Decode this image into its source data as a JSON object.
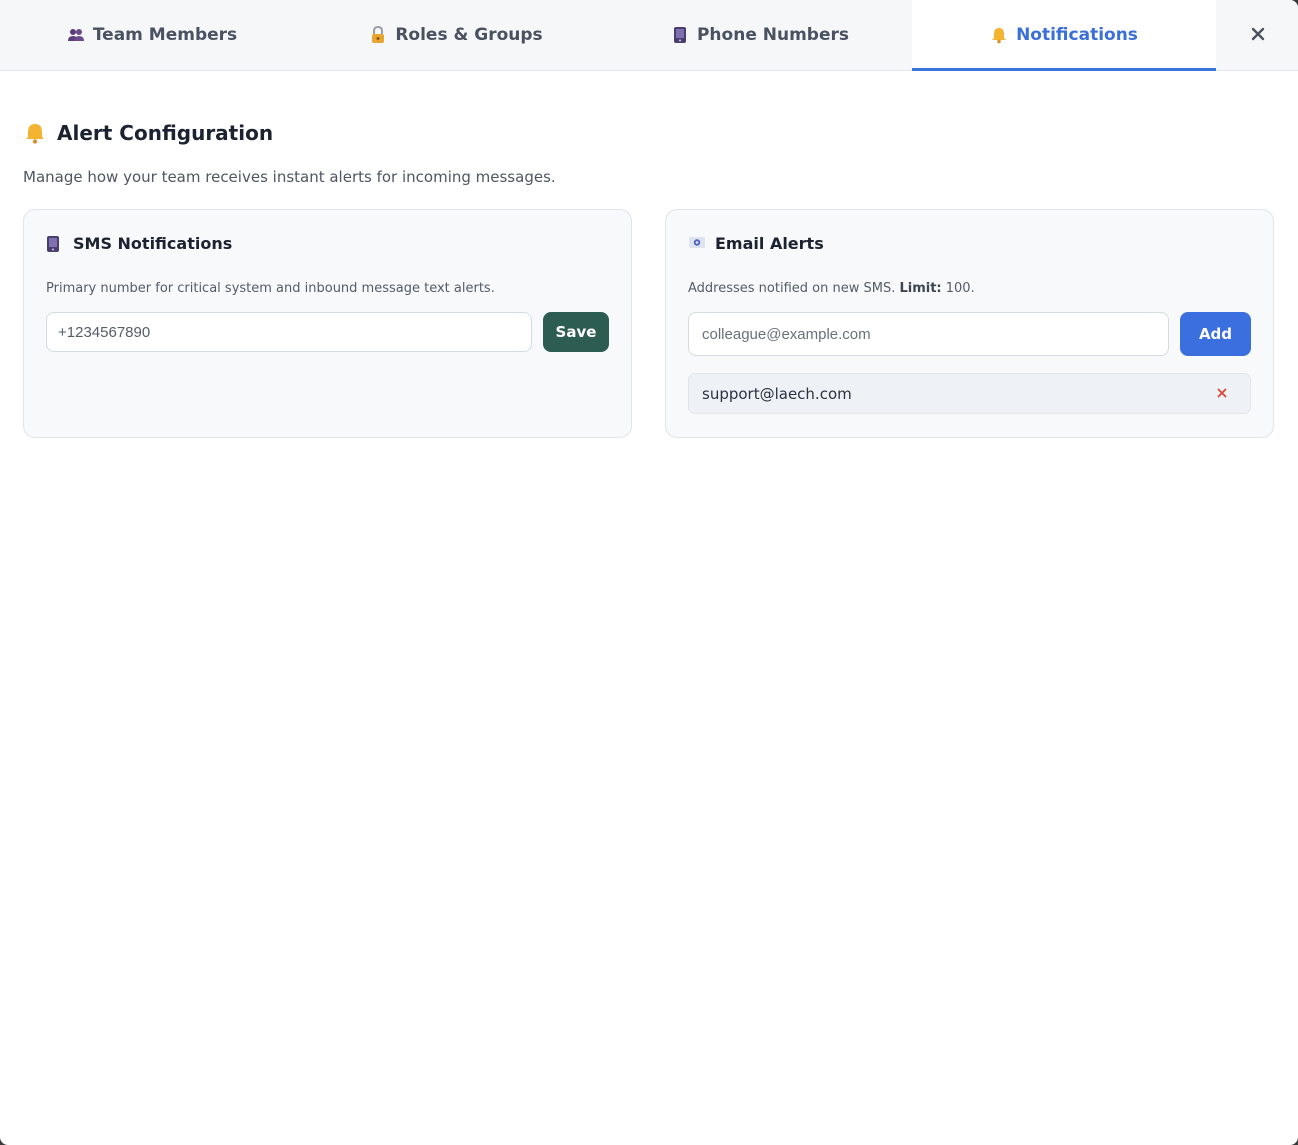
{
  "tabs": [
    {
      "label": "Team Members",
      "icon": "team-members-icon",
      "active": false
    },
    {
      "label": "Roles & Groups",
      "icon": "lock-icon",
      "active": false
    },
    {
      "label": "Phone Numbers",
      "icon": "phone-icon",
      "active": false
    },
    {
      "label": "Notifications",
      "icon": "bell-icon",
      "active": true
    }
  ],
  "close_icon": "close-icon",
  "section": {
    "title": "Alert Configuration",
    "icon": "bell-icon",
    "description": "Manage how your team receives instant alerts for incoming messages."
  },
  "sms": {
    "title": "SMS Notifications",
    "icon": "phone-icon",
    "description": "Primary number for critical system and inbound message text alerts.",
    "phone_value": "+1234567890",
    "save_label": "Save"
  },
  "email": {
    "title": "Email Alerts",
    "icon": "email-icon",
    "description_prefix": "Addresses notified on new SMS. ",
    "limit_label": "Limit:",
    "limit_value": " 100.",
    "input_placeholder": "colleague@example.com",
    "add_label": "Add",
    "addresses": [
      "support@laech.com"
    ]
  },
  "colors": {
    "accent": "#3b74db",
    "save_button": "#2d5c52",
    "add_button": "#3b6fe0",
    "remove": "#d9473a"
  }
}
